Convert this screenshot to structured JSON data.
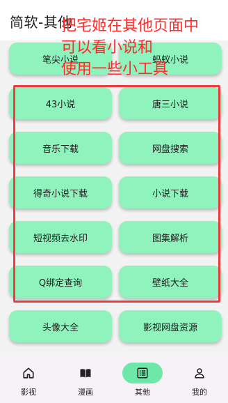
{
  "header": {
    "title": "简软-其他"
  },
  "annotation": {
    "lines": [
      "把宅姬在其他页面中",
      "可以看小说和",
      "使用一些小工具"
    ],
    "color": "#ff2b2b"
  },
  "tools": [
    "笔尖小说",
    "蚂蚁小说",
    "43小说",
    "唐三小说",
    "音乐下载",
    "网盘搜索",
    "得奇小说下载",
    "小说下载",
    "短视频去水印",
    "图集解析",
    "Q绑定查询",
    "壁纸大全",
    "头像大全",
    "影视网盘资源"
  ],
  "colors": {
    "button": "#8ef3bd",
    "active_pill": "#6ee8a8",
    "nav_bg": "#f7f2f7",
    "content_bg": "#f2f2f2"
  },
  "nav": [
    {
      "label": "影视",
      "icon": "home-icon",
      "active": false
    },
    {
      "label": "漫画",
      "icon": "book-icon",
      "active": false
    },
    {
      "label": "其他",
      "icon": "list-icon",
      "active": true
    },
    {
      "label": "我的",
      "icon": "person-icon",
      "active": false
    }
  ]
}
